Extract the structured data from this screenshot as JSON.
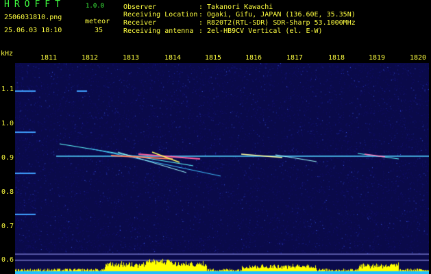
{
  "header": {
    "app_title": "HROFFT",
    "app_version": "1.0.0",
    "filename": "250603181​0.png",
    "datetime": "25.06.03 18:10",
    "meteor_label": "meteor",
    "meteor_count": "35"
  },
  "info": [
    {
      "key": "Observer",
      "value": "Takanori Kawachi"
    },
    {
      "key": "Receiving Location",
      "value": "Ogaki, Gifu, JAPAN (136.60E, 35.35N)"
    },
    {
      "key": "Receiver",
      "value": "R820T2(RTL-SDR) SDR-Sharp 53.1000MHz"
    },
    {
      "key": "Receiving antenna",
      "value": "2el-HB9CV Vertical (el. E-W)"
    }
  ],
  "axis": {
    "y_unit": "kHz",
    "x_ticks": [
      "1811",
      "1812",
      "1813",
      "1814",
      "1815",
      "1816",
      "1817",
      "1818",
      "1819",
      "1820"
    ],
    "y_ticks": [
      "1.1",
      "1.0",
      "0.9",
      "0.8",
      "0.7",
      "0.6"
    ]
  },
  "colors": {
    "text_yellow": "#ffff40",
    "text_green": "#40ff40",
    "spectrogram_bg": "#0a0a4a",
    "signal_line": "#40e0ff",
    "level_bar": "#ffff00",
    "level_base": "#20c0ff"
  }
}
